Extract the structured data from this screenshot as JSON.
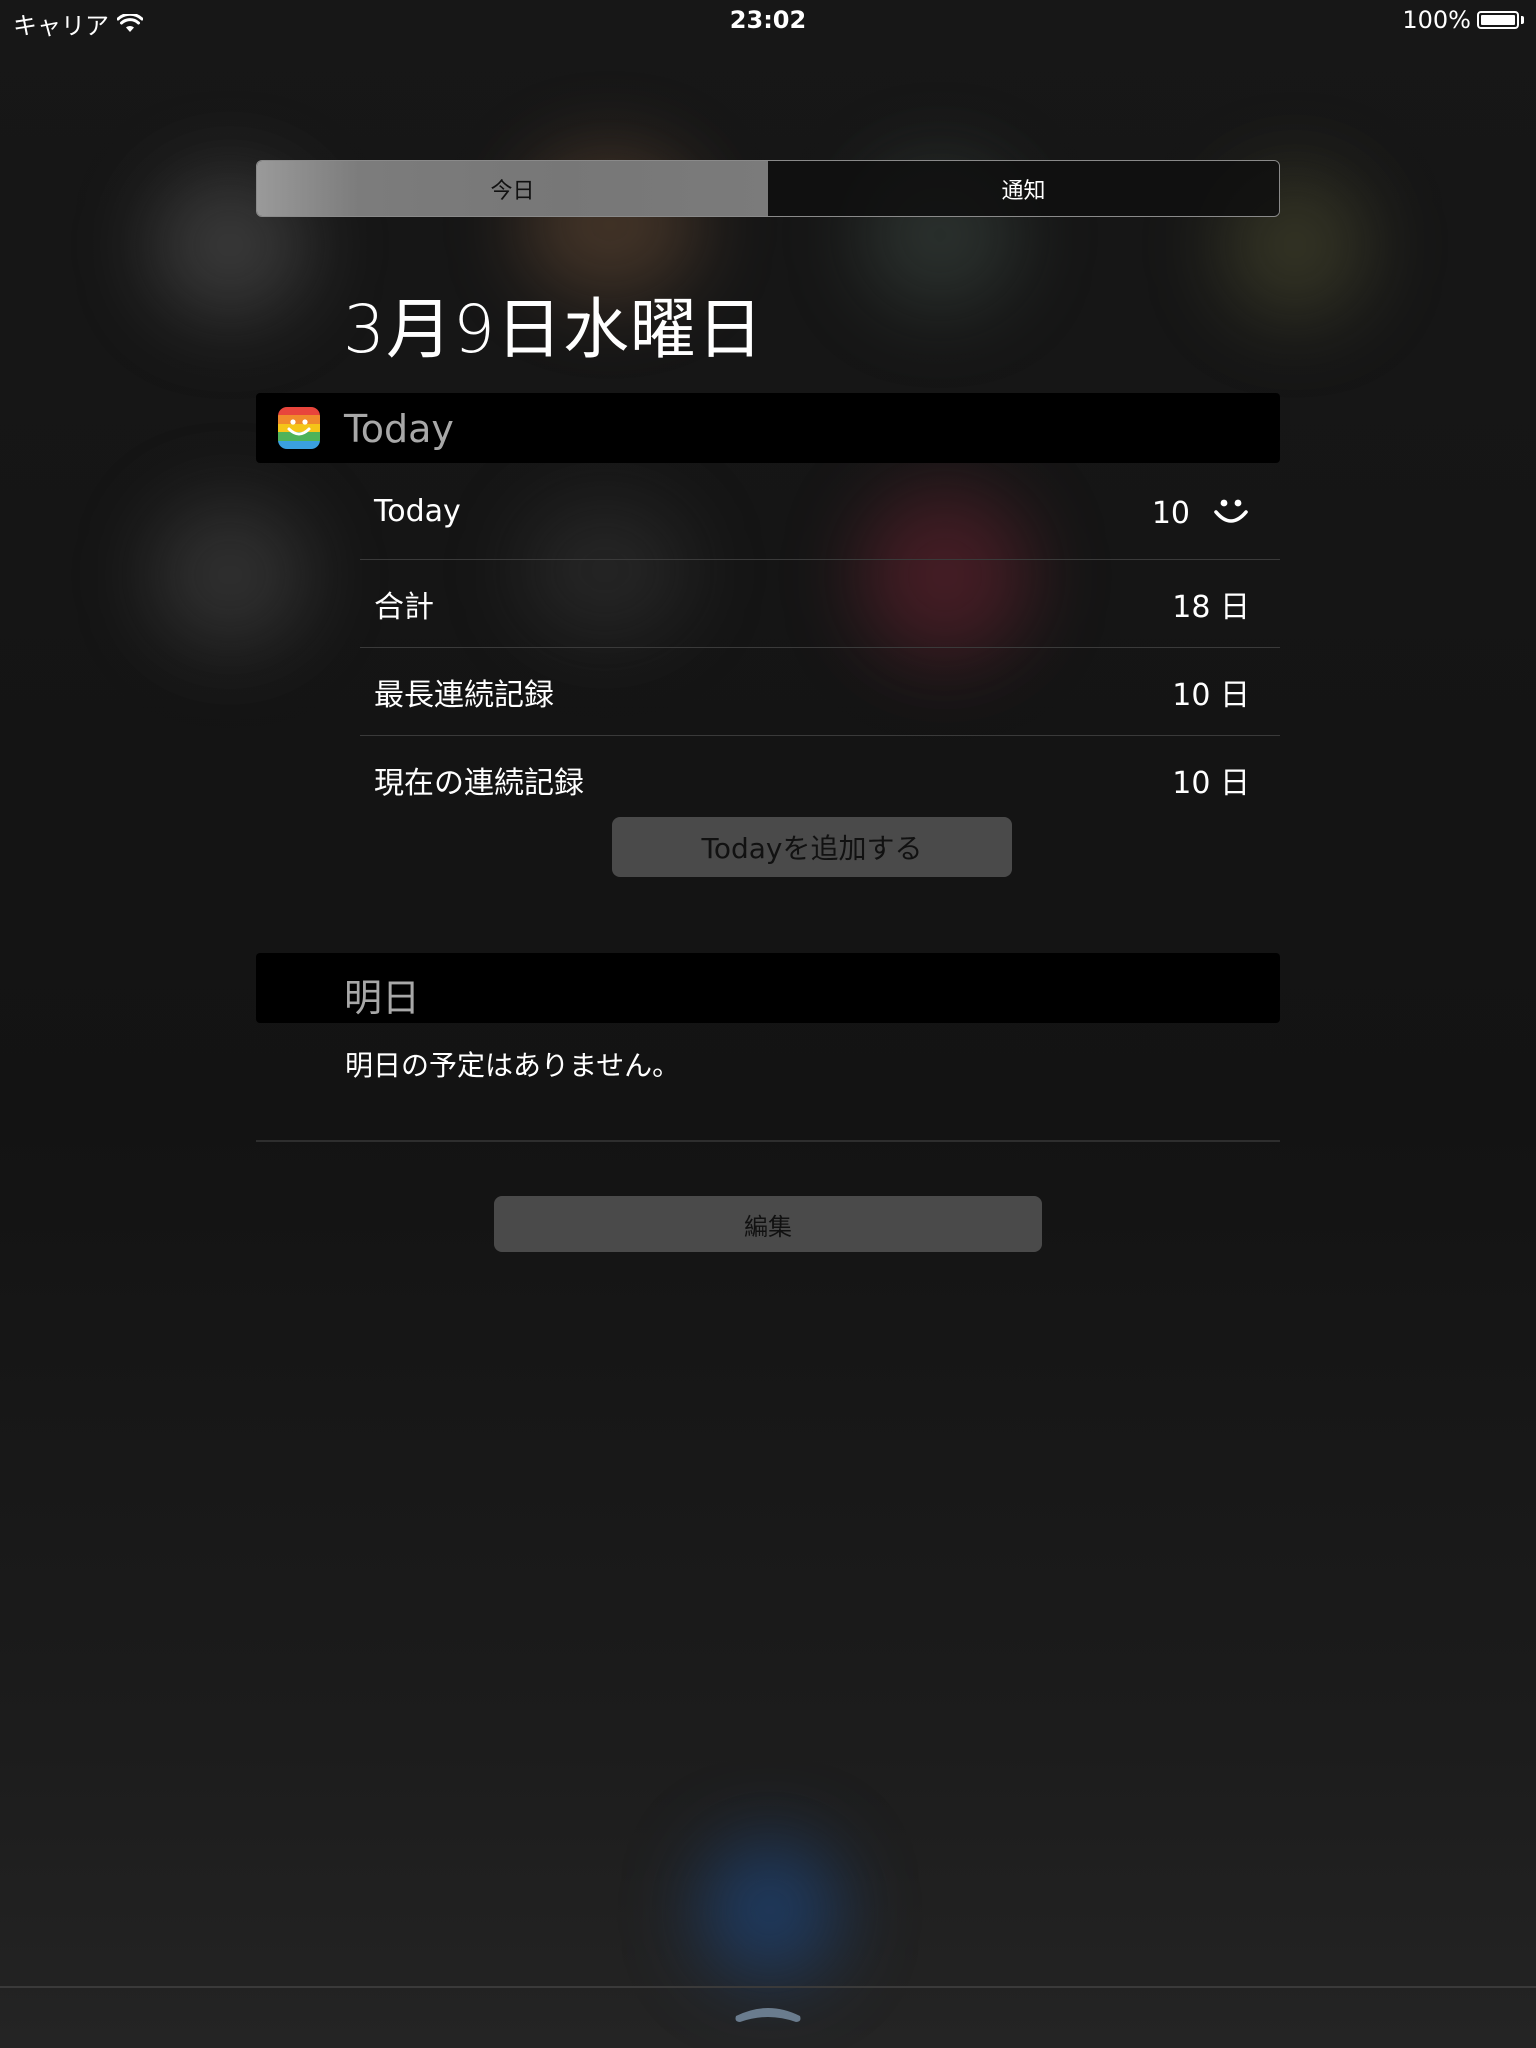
{
  "status_bar": {
    "carrier": "キャリア",
    "time": "23:02",
    "battery_text": "100%",
    "battery_level": 1.0
  },
  "segmented": {
    "today_label": "今日",
    "notifications_label": "通知",
    "selected": "today"
  },
  "date_title": "3月9日水曜日",
  "today_widget": {
    "title": "Today",
    "icon": "rainbow-smile-app-icon",
    "rows": [
      {
        "label": "Today",
        "value": "10",
        "icon": "smile-icon"
      },
      {
        "label": "合計",
        "value": "18 日"
      },
      {
        "label": "最長連続記録",
        "value": "10 日"
      },
      {
        "label": "現在の連続記録",
        "value": "10 日"
      }
    ],
    "add_button_label": "Todayを追加する"
  },
  "tomorrow_widget": {
    "title": "明日",
    "empty_message": "明日の予定はありません。"
  },
  "edit_button_label": "編集",
  "colors": {
    "background": "#151515",
    "header_bg": "#000000",
    "button_bg": "#4a4a4a",
    "separator": "#3a3a3a"
  }
}
